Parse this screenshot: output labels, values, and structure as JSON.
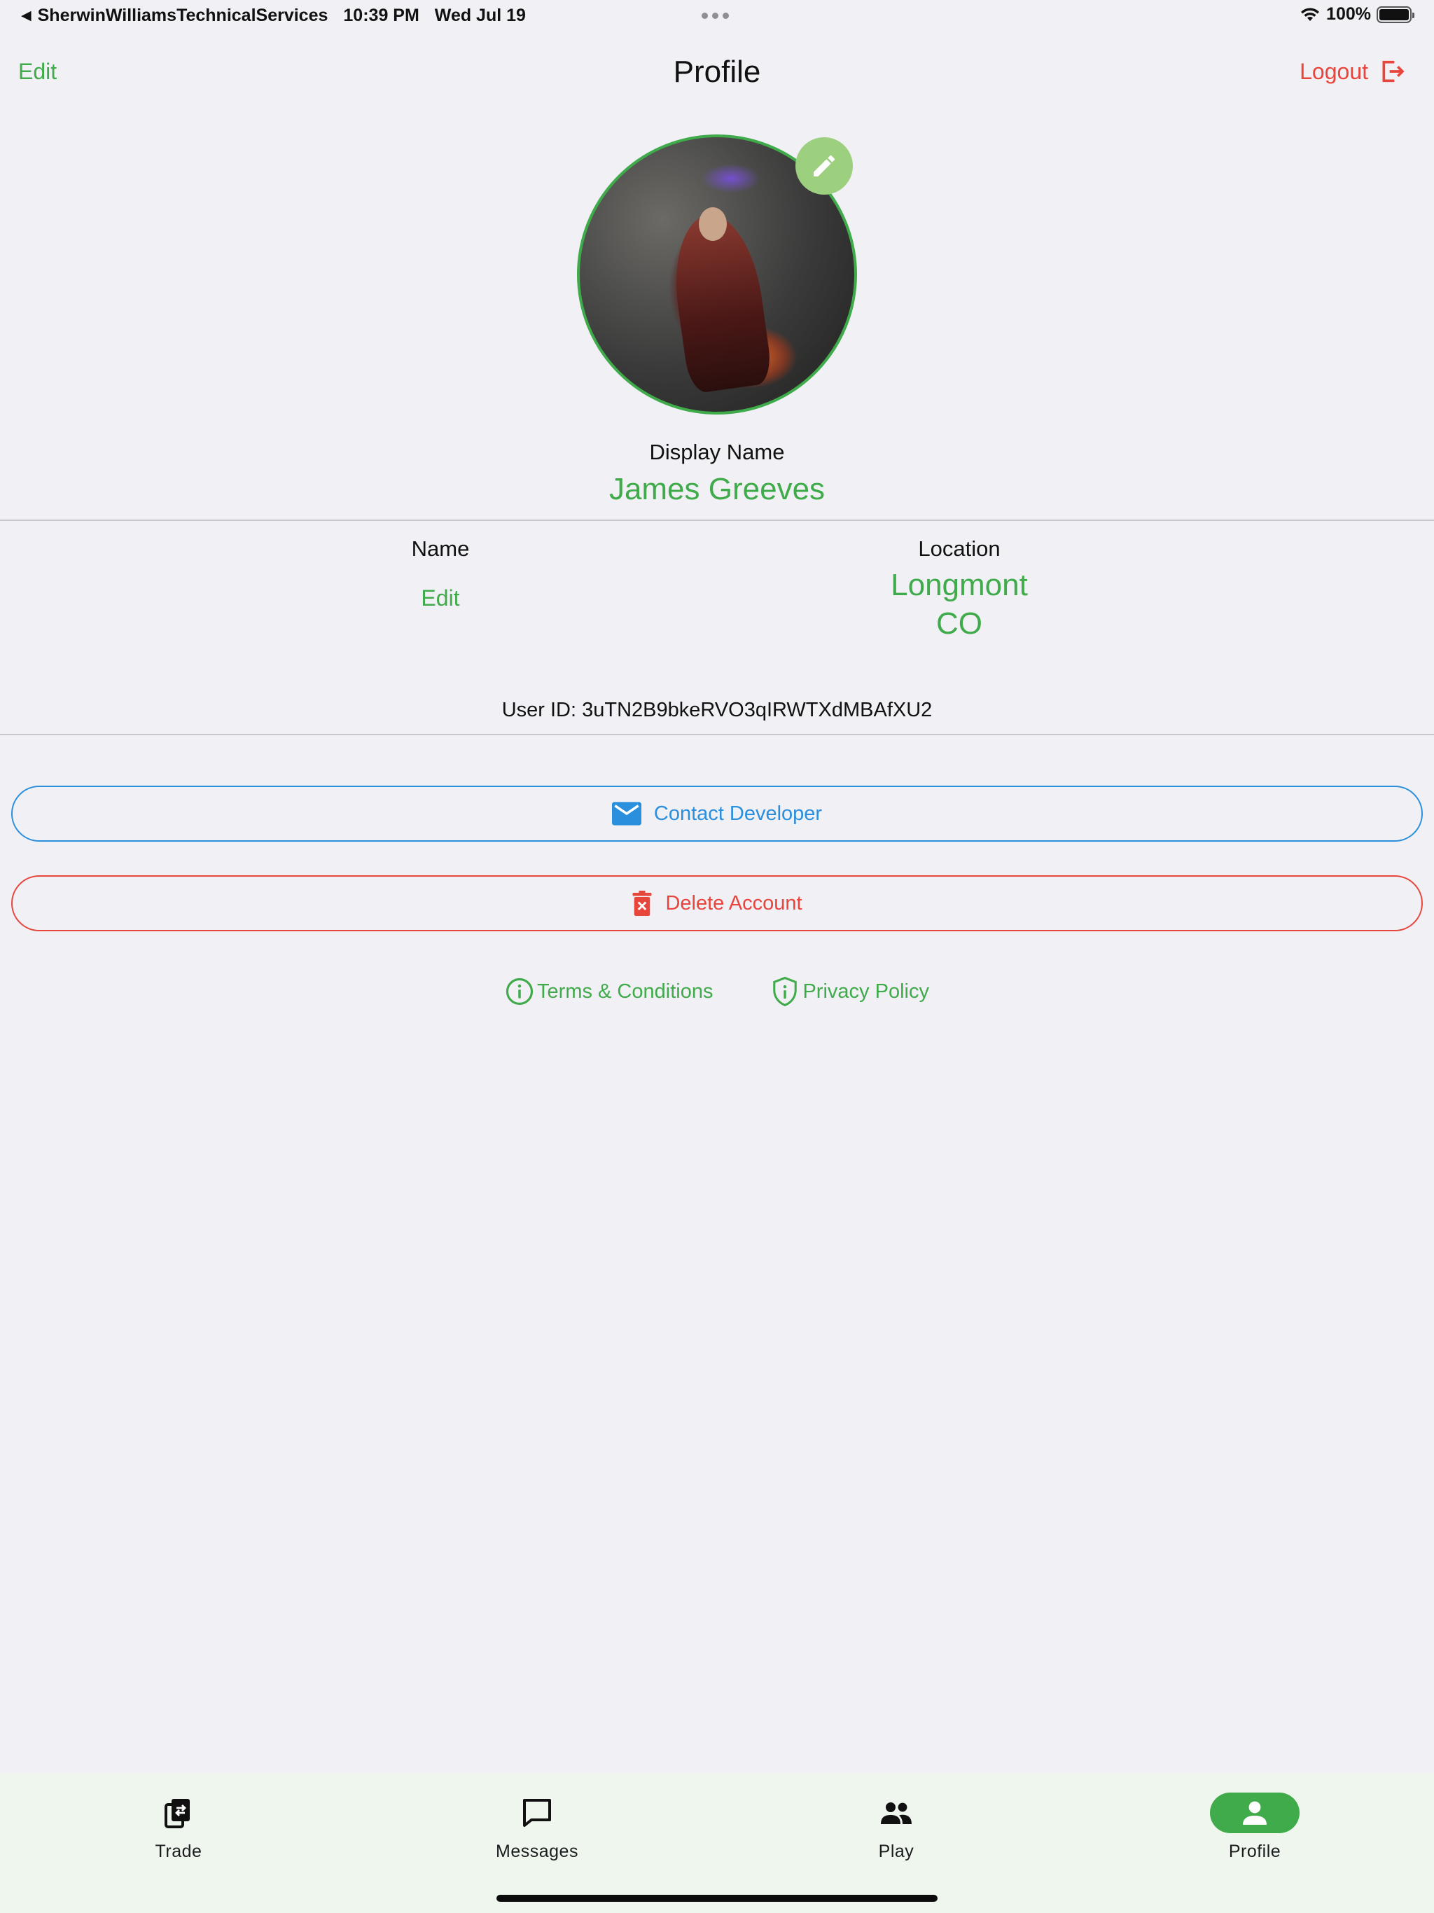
{
  "status_bar": {
    "app_name": "SherwinWilliamsTechnicalServices",
    "time": "10:39 PM",
    "date": "Wed Jul 19",
    "battery": "100%",
    "battery_level": 1.0
  },
  "nav": {
    "edit_label": "Edit",
    "title": "Profile",
    "logout_label": "Logout",
    "logout_icon": "logout-icon"
  },
  "profile": {
    "avatar_edit_icon": "pencil-icon",
    "display_name_label": "Display Name",
    "display_name": "James Greeves",
    "name_label": "Name",
    "name_value": "Edit",
    "location_label": "Location",
    "location_city": "Longmont",
    "location_state": "CO",
    "user_id": "User ID: 3uTN2B9bkeRVO3qIRWTXdMBAfXU2"
  },
  "actions": {
    "contact_label": "Contact Developer",
    "contact_icon": "mail-icon",
    "delete_label": "Delete Account",
    "delete_icon": "trash-icon"
  },
  "links": {
    "terms_label": "Terms & Conditions",
    "terms_icon": "info-circle-icon",
    "privacy_label": "Privacy Policy",
    "privacy_icon": "shield-info-icon"
  },
  "tabs": [
    {
      "label": "Trade",
      "icon": "cards-icon",
      "active": false
    },
    {
      "label": "Messages",
      "icon": "chat-bubble-icon",
      "active": false
    },
    {
      "label": "Play",
      "icon": "people-icon",
      "active": false
    },
    {
      "label": "Profile",
      "icon": "person-icon",
      "active": true
    }
  ],
  "colors": {
    "background": "#F1F0F5",
    "accent_green": "#3FAB4A",
    "danger_red": "#E8453C",
    "link_blue": "#2A8FDD",
    "tab_bar": "#EFF6EE"
  }
}
